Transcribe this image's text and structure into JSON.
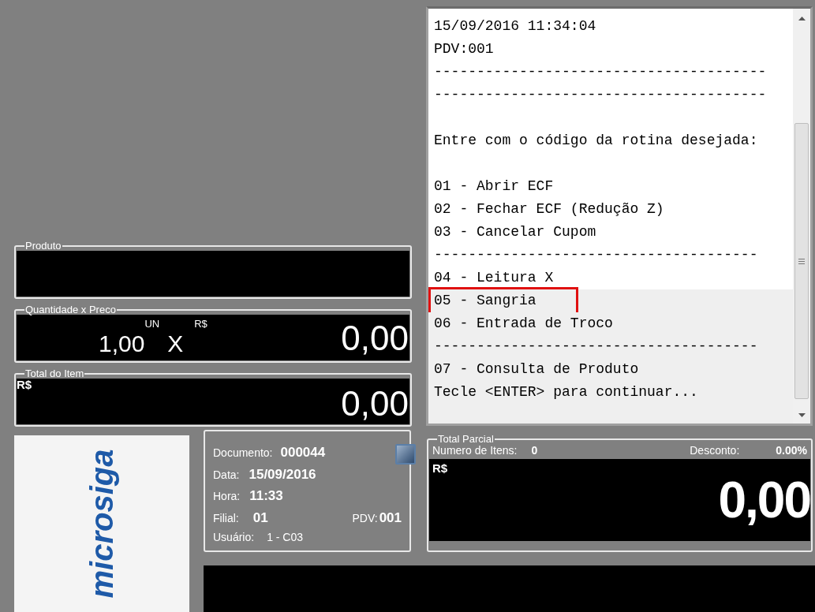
{
  "produto": {
    "legend": "Produto"
  },
  "quantidade": {
    "legend": "Quantidade x Preco",
    "qty": "1,00",
    "unit": "UN",
    "times": "X",
    "currency": "R$",
    "price": "0,00"
  },
  "total_item": {
    "legend": "Total do Item",
    "currency": "R$",
    "value": "0,00"
  },
  "receipt": {
    "lines": [
      {
        "kind": "text",
        "text": "15/09/2016 11:34:04",
        "selected": false
      },
      {
        "kind": "text",
        "text": "PDV:001",
        "selected": false
      },
      {
        "kind": "text",
        "text": "---------------------------------------",
        "selected": false
      },
      {
        "kind": "text",
        "text": "---------------------------------------",
        "selected": false
      },
      {
        "kind": "blank"
      },
      {
        "kind": "text",
        "text": "Entre com o código da rotina desejada:",
        "selected": false
      },
      {
        "kind": "blank"
      },
      {
        "kind": "text",
        "text": "01 - Abrir ECF",
        "selected": false
      },
      {
        "kind": "text",
        "text": "02 - Fechar ECF (Redução Z)",
        "selected": false
      },
      {
        "kind": "text",
        "text": "03 - Cancelar Cupom",
        "selected": false
      },
      {
        "kind": "text",
        "text": "--------------------------------------",
        "selected": false
      },
      {
        "kind": "text",
        "text": "04 - Leitura X",
        "selected": false
      },
      {
        "kind": "text",
        "text": "05 - Sangria",
        "selected": true
      },
      {
        "kind": "text",
        "text": "06 - Entrada de Troco",
        "selected": false
      },
      {
        "kind": "text",
        "text": "--------------------------------------",
        "selected": false
      },
      {
        "kind": "text",
        "text": "07 - Consulta de Produto",
        "selected": false
      },
      {
        "kind": "text",
        "text": "Tecle <ENTER> para continuar...",
        "selected": false
      }
    ]
  },
  "logo": {
    "text": "microsiga"
  },
  "info": {
    "documento_label": "Documento:",
    "documento": "000044",
    "data_label": "Data:",
    "data": "15/09/2016",
    "hora_label": "Hora:",
    "hora": "11:33",
    "filial_label": "Filial:",
    "filial": "01",
    "pdv_label": "PDV:",
    "pdv": "001",
    "usuario_label": "Usuário:",
    "usuario": "1 - C03"
  },
  "total_parcial": {
    "legend": "Total Parcial",
    "itens_label": "Numero de Itens:",
    "itens": "0",
    "desconto_label": "Desconto:",
    "desconto": "0.00%",
    "currency": "R$",
    "value": "0,00"
  }
}
